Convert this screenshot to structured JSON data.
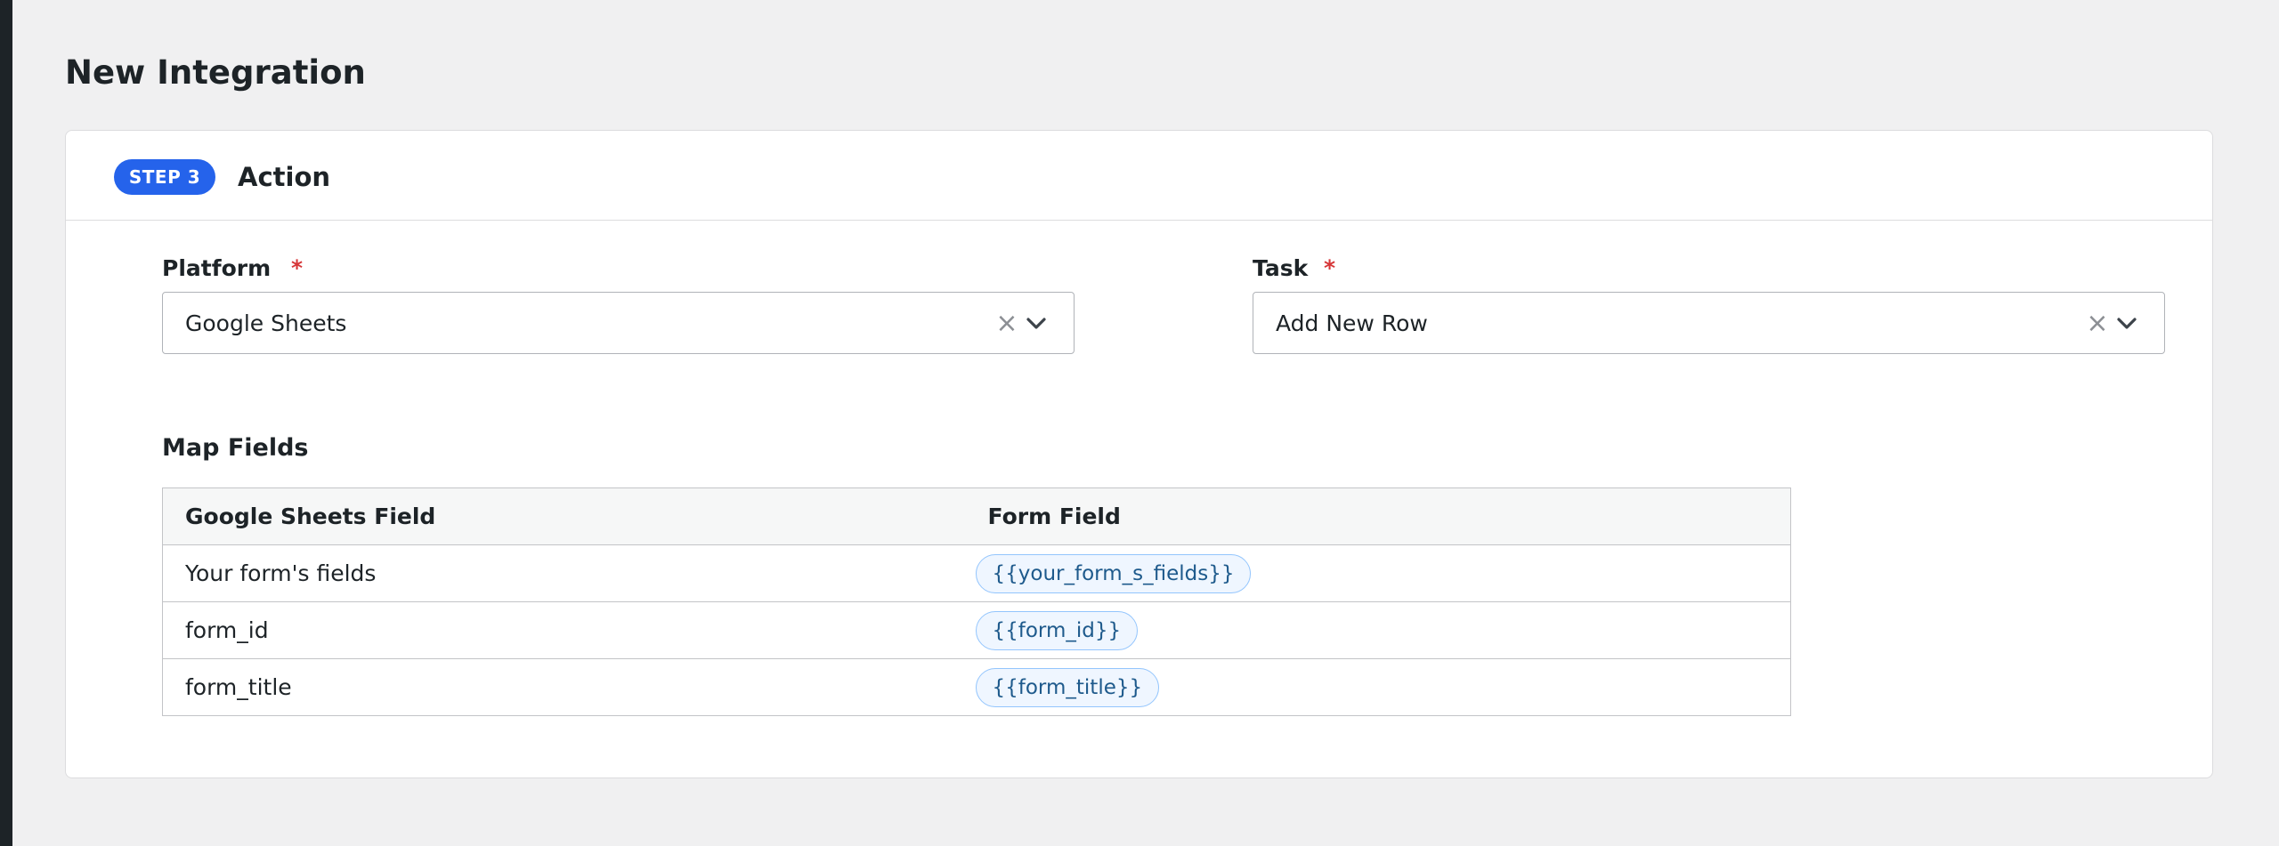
{
  "page": {
    "title": "New Integration"
  },
  "step": {
    "badge": "STEP 3",
    "title": "Action"
  },
  "platform": {
    "label": "Platform",
    "required_mark": "*",
    "value": "Google Sheets",
    "clear_glyph": "×"
  },
  "task": {
    "label": "Task",
    "required_mark": "*",
    "value": "Add New Row",
    "clear_glyph": "×"
  },
  "map_fields": {
    "title": "Map Fields",
    "columns": [
      "Google Sheets Field",
      "Form Field"
    ],
    "rows": [
      {
        "field": "Your form's fields",
        "token": "{{your_form_s_fields}}"
      },
      {
        "field": "form_id",
        "token": "{{form_id}}"
      },
      {
        "field": "form_title",
        "token": "{{form_title}}"
      }
    ]
  },
  "colors": {
    "accent": "#2563eb",
    "required": "#d63638",
    "token_bg": "#eff6ff",
    "token_border": "#93c5fd",
    "token_text": "#1e5a8c"
  },
  "icons": {
    "clear": "close-icon",
    "dropdown": "chevron-down-icon"
  }
}
